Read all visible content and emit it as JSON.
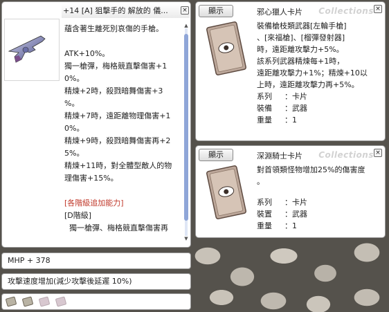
{
  "main": {
    "title": "+14 [A] 狙擊手的 解放的 儀...",
    "close": "×",
    "description_lines": [
      "蘊含著生離死別哀傷的手槍。",
      "",
      "ATK+10%。",
      "獨一槍彈，梅格競直擊傷害+1",
      "0%。",
      "精煉+2時，殺戮暗舞傷害+3",
      "%。",
      "精煉+7時，遠距離物理傷害+1",
      "0%。",
      "精煉+9時，殺戮暗舞傷害再+2",
      "5%。",
      "精煉+11時，對全體型敵人的物",
      "理傷害+15%。",
      "",
      "[各階級追加能力]",
      "[D階級]",
      "  獨一槍彈、梅格競直擊傷害再"
    ]
  },
  "bars": {
    "mhp": "MHP + 378",
    "aspd": "攻擊速度增加(減少攻擊後延遲 10%)"
  },
  "cards": [
    {
      "show_label": "顯示",
      "title": "邪心獵人卡片",
      "watermark": "Collections",
      "close": "×",
      "lines": [
        "裝備槍枝類武器[左輪手槍]",
        "、[來福槍]、[榴彈發射器]",
        "時，遠距離攻擊力+5%。",
        "該系列武器精煉每+1時，",
        "遠距離攻擊力+1%；精煉+10以",
        "上時，遠距離攻擊力再+5%。"
      ],
      "props": [
        {
          "k": "系列",
          "v": "：卡片"
        },
        {
          "k": "裝備",
          "v": "：武器"
        },
        {
          "k": "重量",
          "v": "：1"
        }
      ]
    },
    {
      "show_label": "顯示",
      "title": "深淵騎士卡片",
      "watermark": "Collections",
      "close": "×",
      "lines": [
        "對首領類怪物增加25%的傷害度",
        "。"
      ],
      "props": [
        {
          "k": "系列",
          "v": "：卡片"
        },
        {
          "k": "裝置",
          "v": "：武器"
        },
        {
          "k": "重量",
          "v": "：1"
        }
      ]
    }
  ],
  "colors": {
    "red_text": "#c0392b",
    "scroll_thumb": "#8fa6d8"
  }
}
